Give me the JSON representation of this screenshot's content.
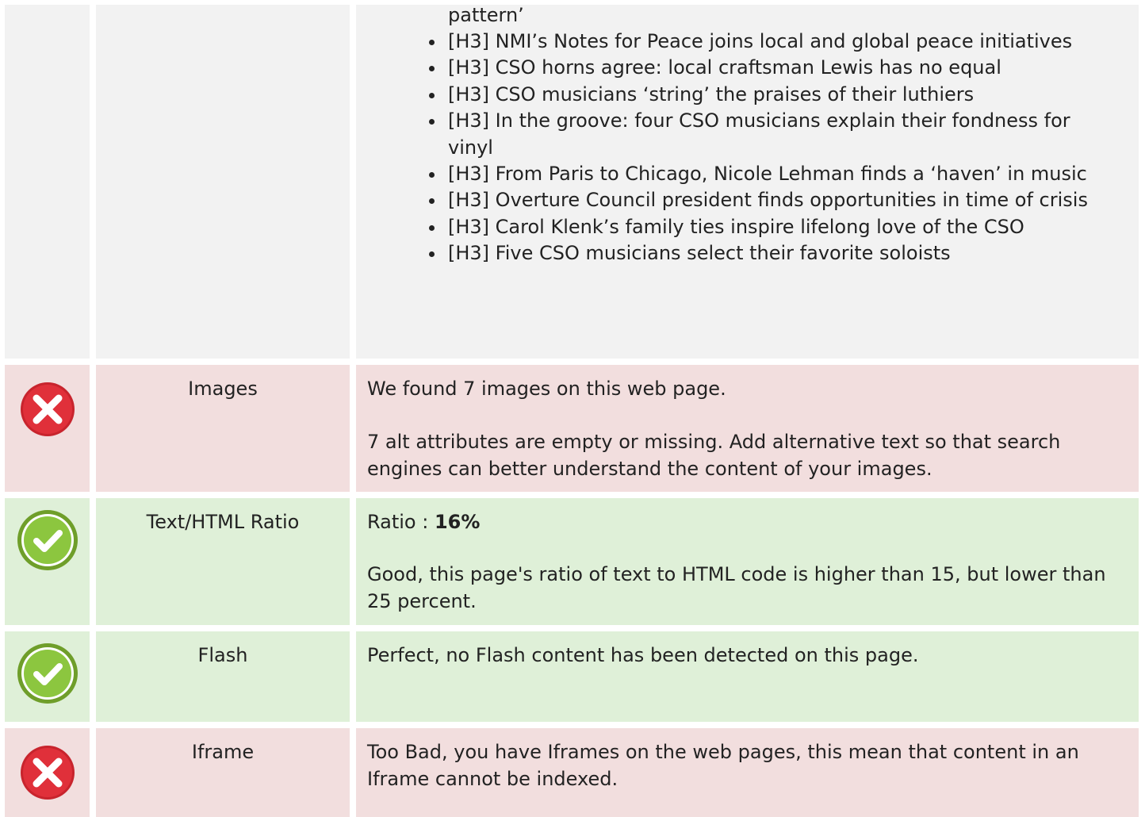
{
  "headings_section": {
    "continued_text": "pattern’",
    "items": [
      "[H3] NMI’s Notes for Peace joins local and global peace initiatives",
      "[H3] CSO horns agree: local craftsman Lewis has no equal",
      "[H3] CSO musicians ‘string’ the praises of their luthiers",
      "[H3] In the groove: four CSO musicians explain their fondness for vinyl",
      "[H3] From Paris to Chicago, Nicole Lehman finds a ‘haven’ in music",
      "[H3] Overture Council president finds opportunities in time of crisis",
      "[H3] Carol Klenk’s family ties inspire lifelong love of the CSO",
      "[H3] Five CSO musicians select their favorite soloists"
    ]
  },
  "rows": {
    "images": {
      "status": "error",
      "icon": "error-x-icon",
      "name": "Images",
      "line1": "We found 7 images on this web page.",
      "line2": "7 alt attributes are empty or missing. Add alternative text so that search engines can better understand the content of your images."
    },
    "text_html_ratio": {
      "status": "pass",
      "icon": "check-icon",
      "name": "Text/HTML Ratio",
      "ratio_label": "Ratio : ",
      "ratio_value": "16%",
      "line2": "Good, this page's ratio of text to HTML code is higher than 15, but lower than 25 percent."
    },
    "flash": {
      "status": "pass",
      "icon": "check-icon",
      "name": "Flash",
      "line1": "Perfect, no Flash content has been detected on this page."
    },
    "iframe": {
      "status": "error",
      "icon": "error-x-icon",
      "name": "Iframe",
      "line1": "Too Bad, you have Iframes on the web pages, this mean that content in an Iframe cannot be indexed."
    }
  },
  "colors": {
    "error_bg": "#f2dede",
    "pass_bg": "#dff0d8",
    "neutral_bg": "#f2f2f2",
    "error_icon": "#e0303a",
    "pass_icon": "#8cc63f"
  }
}
